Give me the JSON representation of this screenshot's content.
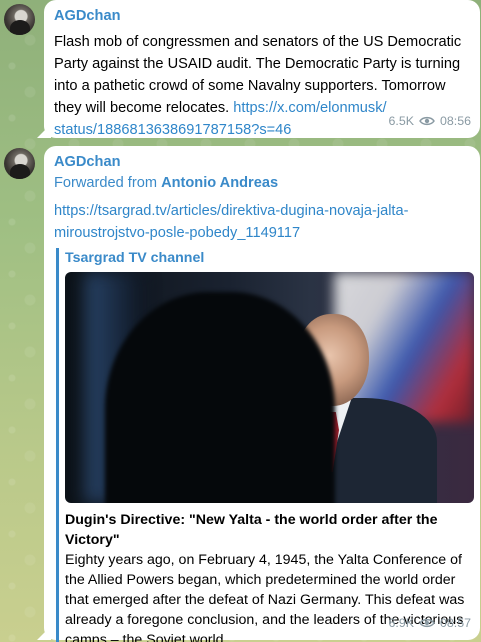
{
  "messages": [
    {
      "sender": "AGDchan",
      "text": "Flash mob of congressmen and senators of the US Democratic Party against the USAID audit. The Democratic Party is turning into a pathetic crowd of some Navalny supporters. Tomorrow they will become relocates.",
      "link": "https://x.com/elonmusk/status/1886813638691787158?s=46",
      "link_line1": "https://x.com/elonmusk/",
      "link_line2": "status/1886813638691787158?s=46",
      "views": "6.5K",
      "time": "08:56"
    },
    {
      "sender": "AGDchan",
      "forwarded_prefix": "Forwarded from ",
      "forwarded_from": "Antonio Andreas",
      "link_line1": "https://tsargrad.tv/articles/direktiva-dugina-novaja-jalta-",
      "link_line2": "miroustrojstvo-posle-pobedy_1149117",
      "preview": {
        "site": "Tsargrad TV channel",
        "title": "Dugin's Directive: \"New Yalta - the world order after the Victory\"",
        "description": "Eighty years ago, on February 4, 1945, the Yalta Conference of the Allied Powers began, which predetermined the world order that emerged after the defeat of Nazi Germany. This defeat was already a foregone conclusion, and the leaders of the victorious camps – the Soviet world…"
      },
      "views": "6.9K",
      "time": "08:57"
    }
  ],
  "colors": {
    "accent": "#3a8ac9",
    "link": "#2f86c9",
    "meta": "#8a9aa3",
    "bubble": "#ffffff"
  },
  "icons": [
    "views-eye-icon",
    "avatar-image"
  ]
}
